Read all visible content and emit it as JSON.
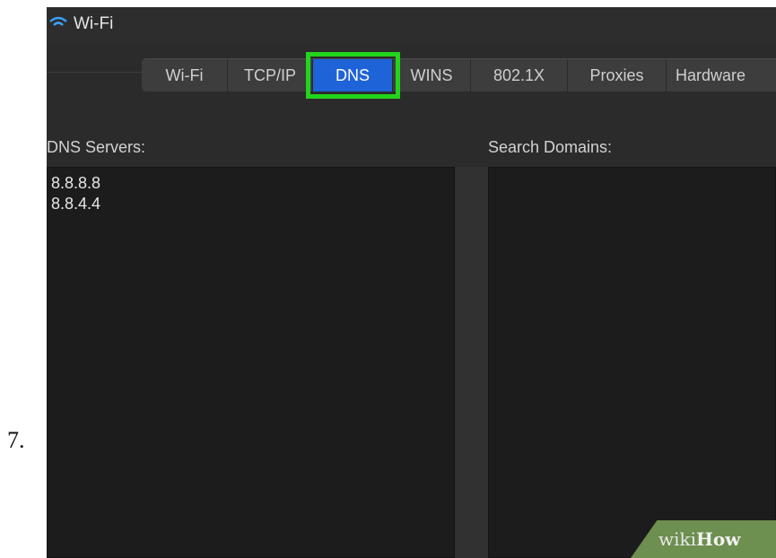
{
  "step": {
    "number": "7."
  },
  "window": {
    "title": "Wi-Fi",
    "icon": "wifi-icon"
  },
  "tabs": [
    {
      "label": "Wi-Fi",
      "active": false
    },
    {
      "label": "TCP/IP",
      "active": false
    },
    {
      "label": "DNS",
      "active": true
    },
    {
      "label": "WINS",
      "active": false
    },
    {
      "label": "802.1X",
      "active": false
    },
    {
      "label": "Proxies",
      "active": false
    },
    {
      "label": "Hardware",
      "active": false
    }
  ],
  "dns_servers": {
    "label": "DNS Servers:",
    "items": [
      "8.8.8.8",
      "8.8.4.4"
    ]
  },
  "search_domains": {
    "label": "Search Domains:",
    "items": []
  },
  "watermark": {
    "wiki": "wiki",
    "how": "How"
  },
  "colors": {
    "highlight": "#22d41c",
    "active_tab": "#1f63d9",
    "panel_bg": "#2b2b2b"
  }
}
